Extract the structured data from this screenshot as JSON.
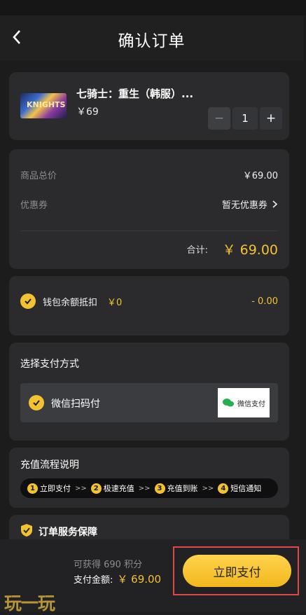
{
  "header": {
    "title": "确认订单"
  },
  "product": {
    "name": "七骑士：重生（韩服）...",
    "price": "￥69",
    "quantity": "1",
    "thumb_text": "KNIGHTS",
    "minus": "−",
    "plus": "+"
  },
  "summary": {
    "subtotal_label": "商品总价",
    "subtotal_value": "￥69.00",
    "coupon_label": "优惠券",
    "coupon_value": "暂无优惠券",
    "total_label": "合计:",
    "total_value": "￥ 69.00"
  },
  "wallet": {
    "label": "钱包余额抵扣",
    "amount": "￥0",
    "deduct": "- 0.00"
  },
  "payment": {
    "title": "选择支付方式",
    "method": "微信扫码付",
    "logo_text": "微信支付"
  },
  "process": {
    "title": "充值流程说明",
    "steps": [
      {
        "num": "1",
        "label": "立即支付"
      },
      {
        "num": "2",
        "label": "极速充值"
      },
      {
        "num": "3",
        "label": "充值到账"
      },
      {
        "num": "4",
        "label": "短信通知"
      }
    ],
    "separator": ">>"
  },
  "guarantee": {
    "title": "订单服务保障"
  },
  "footer": {
    "points": "可获得 690 积分",
    "pay_label": "支付金额:",
    "pay_value": "￥ 69.00",
    "pay_button": "立即支付"
  },
  "watermark": "玩一玩",
  "colors": {
    "accent": "#f2c231",
    "background": "#1c1c1c",
    "card": "#2b2b2d",
    "highlight": "#e04848"
  }
}
